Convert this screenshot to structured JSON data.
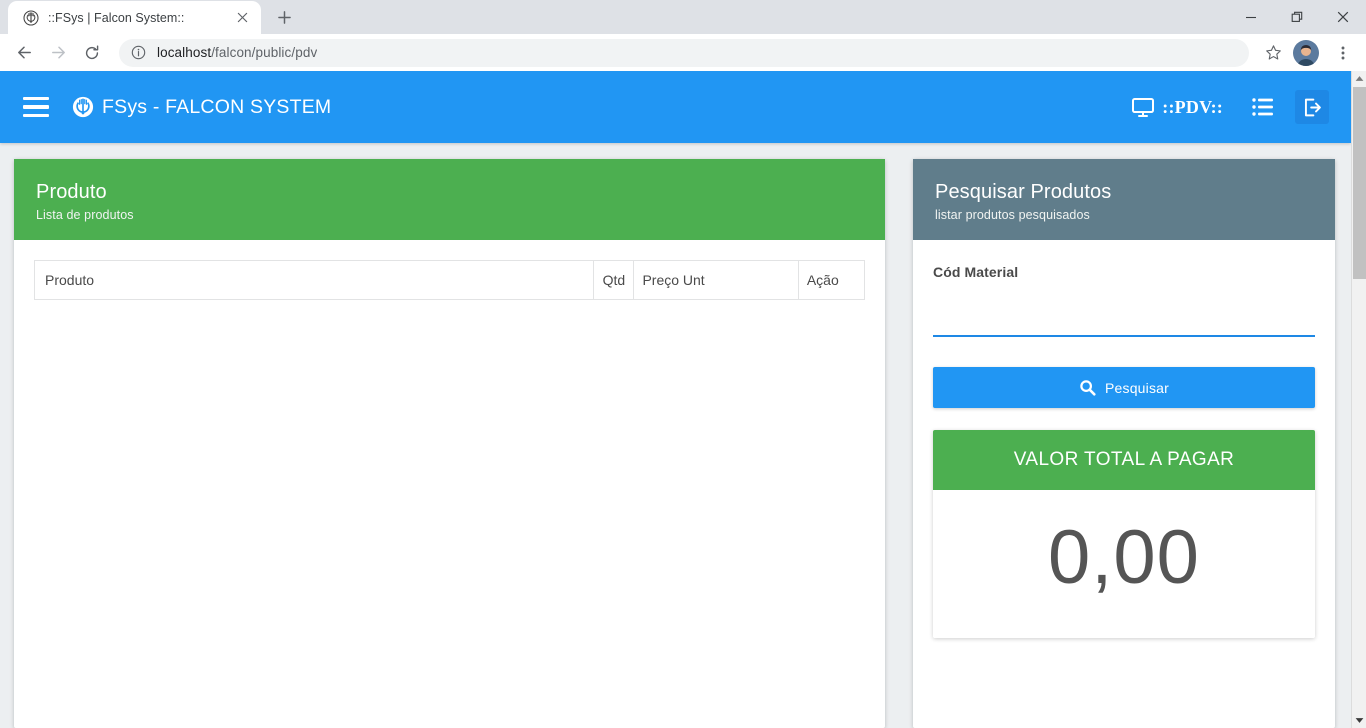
{
  "browser": {
    "tab": {
      "title": "::FSys | Falcon System::",
      "favicon": "jedi-order-logo-icon",
      "close_label": "✕"
    },
    "newtab_label": "+",
    "window_controls": {
      "minimize": "—",
      "restore": "❐",
      "close": "✕"
    },
    "toolbar": {
      "back": "back-arrow-icon",
      "forward": "forward-arrow-icon",
      "reload": "reload-icon",
      "site_info": "info-circle-icon",
      "url_host": "localhost",
      "url_path": "/falcon/public/pdv",
      "url_full": "localhost/falcon/public/pdv",
      "bookmark": "star-icon",
      "profile": "profile-avatar",
      "menu": "three-dot-menu-icon"
    }
  },
  "app": {
    "header": {
      "menu_toggle": "hamburger-icon",
      "brand_logo": "falcon-logo-icon",
      "brand_text": "FSys - FALCON SYSTEM",
      "pdv_label": "::PDV::",
      "pdv_icon": "monitor-icon",
      "list_icon": "list-icon",
      "logout_icon": "logout-icon",
      "bg_color": "#2196f3"
    },
    "product_panel": {
      "title": "Produto",
      "subtitle": "Lista de produtos",
      "header_color": "#4caf50",
      "table": {
        "columns": [
          "Produto",
          "Qtd",
          "Preço Unt",
          "Ação"
        ],
        "rows": []
      }
    },
    "search_panel": {
      "title": "Pesquisar Produtos",
      "subtitle": "listar produtos pesquisados",
      "header_color": "#607d8b",
      "field_label": "Cód Material",
      "field_value": "",
      "field_placeholder": "",
      "search_button": {
        "label": "Pesquisar",
        "icon": "search-icon",
        "color": "#2196f3"
      },
      "total": {
        "label": "VALOR TOTAL A PAGAR",
        "value": "0,00",
        "header_color": "#4caf50"
      }
    }
  }
}
